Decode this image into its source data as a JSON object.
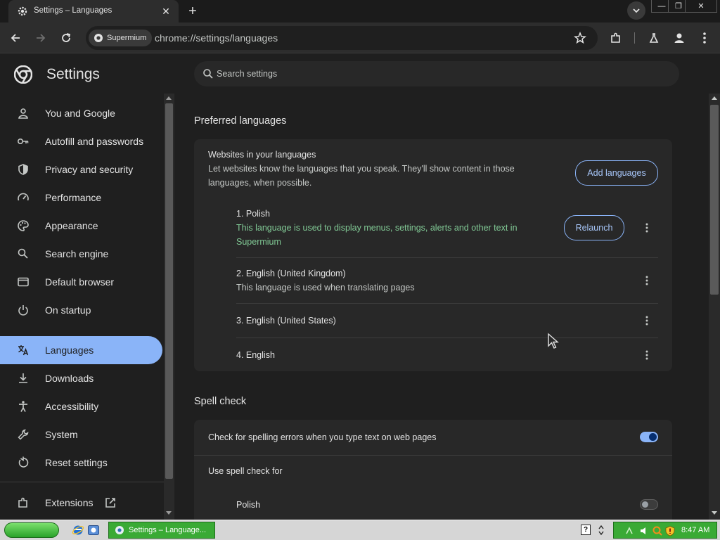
{
  "tab": {
    "title": "Settings – Languages",
    "close": "✕",
    "new_tab": "+"
  },
  "window": {
    "minimize": "—",
    "restore": "❐",
    "close": "✕"
  },
  "toolbar": {
    "site_chip": "Supermium",
    "url": "chrome://settings/languages"
  },
  "header": {
    "title": "Settings",
    "search_placeholder": "Search settings"
  },
  "sidebar": {
    "items": [
      {
        "label": "You and Google",
        "icon": "person-icon"
      },
      {
        "label": "Autofill and passwords",
        "icon": "key-icon"
      },
      {
        "label": "Privacy and security",
        "icon": "shield-icon"
      },
      {
        "label": "Performance",
        "icon": "speedometer-icon"
      },
      {
        "label": "Appearance",
        "icon": "palette-icon"
      },
      {
        "label": "Search engine",
        "icon": "search-icon"
      },
      {
        "label": "Default browser",
        "icon": "browser-window-icon"
      },
      {
        "label": "On startup",
        "icon": "power-icon"
      },
      {
        "label": "Languages",
        "icon": "translate-icon",
        "active": true
      },
      {
        "label": "Downloads",
        "icon": "download-icon"
      },
      {
        "label": "Accessibility",
        "icon": "accessibility-icon"
      },
      {
        "label": "System",
        "icon": "wrench-icon"
      },
      {
        "label": "Reset settings",
        "icon": "reset-icon"
      }
    ],
    "extensions": {
      "label": "Extensions",
      "icon": "puzzle-icon"
    }
  },
  "preferred": {
    "title": "Preferred languages",
    "card_title": "Websites in your languages",
    "card_desc_line1": "Let websites know the languages that you speak. They'll show content in those",
    "card_desc_line2": "languages, when possible.",
    "add_button": "Add languages",
    "languages": [
      {
        "name": "1. Polish",
        "note_line1": "This language is used to display menus, settings, alerts and other text in",
        "note_line2": "Supermium",
        "action": "Relaunch"
      },
      {
        "name": "2. English (United Kingdom)",
        "note": "This language is used when translating pages"
      },
      {
        "name": "3. English (United States)"
      },
      {
        "name": "4. English"
      }
    ]
  },
  "spellcheck": {
    "title": "Spell check",
    "toggle_label": "Check for spelling errors when you type text on web pages",
    "toggle_on": true,
    "use_for": "Use spell check for",
    "languages": [
      {
        "name": "Polish",
        "enabled": false
      }
    ]
  },
  "taskbar": {
    "task_label": "Settings – Language...",
    "clock": "8:47 AM"
  },
  "colors": {
    "accent": "#8ab4f8",
    "green_note": "#81c995",
    "taskbar_green": "#3aaa35"
  }
}
